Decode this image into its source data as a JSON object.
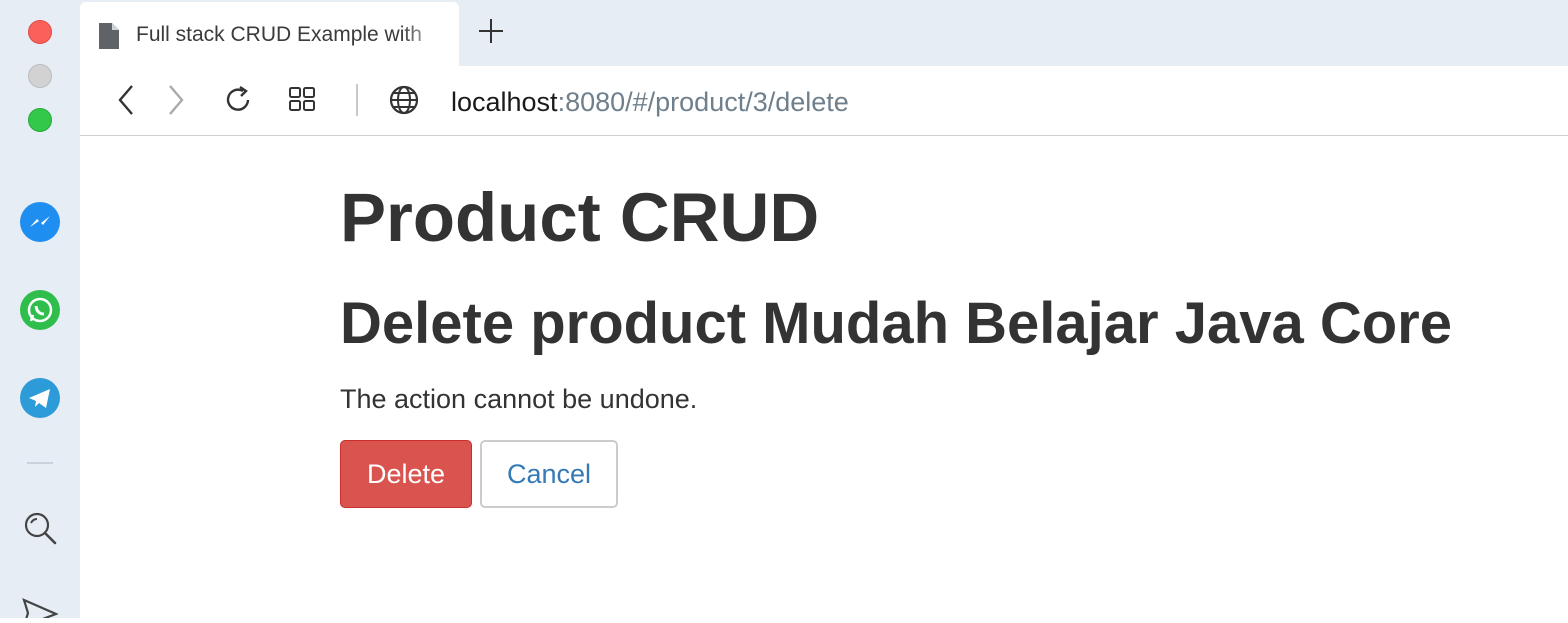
{
  "browser": {
    "tab": {
      "title": "Full stack CRUD Example with"
    },
    "address": {
      "host": "localhost",
      "path": ":8080/#/product/3/delete"
    }
  },
  "page": {
    "title": "Product CRUD",
    "heading": "Delete product Mudah Belajar Java Core",
    "message": "The action cannot be undone.",
    "delete_label": "Delete",
    "cancel_label": "Cancel"
  },
  "colors": {
    "danger": "#d9534f",
    "link": "#337ab7",
    "text": "#333333"
  }
}
